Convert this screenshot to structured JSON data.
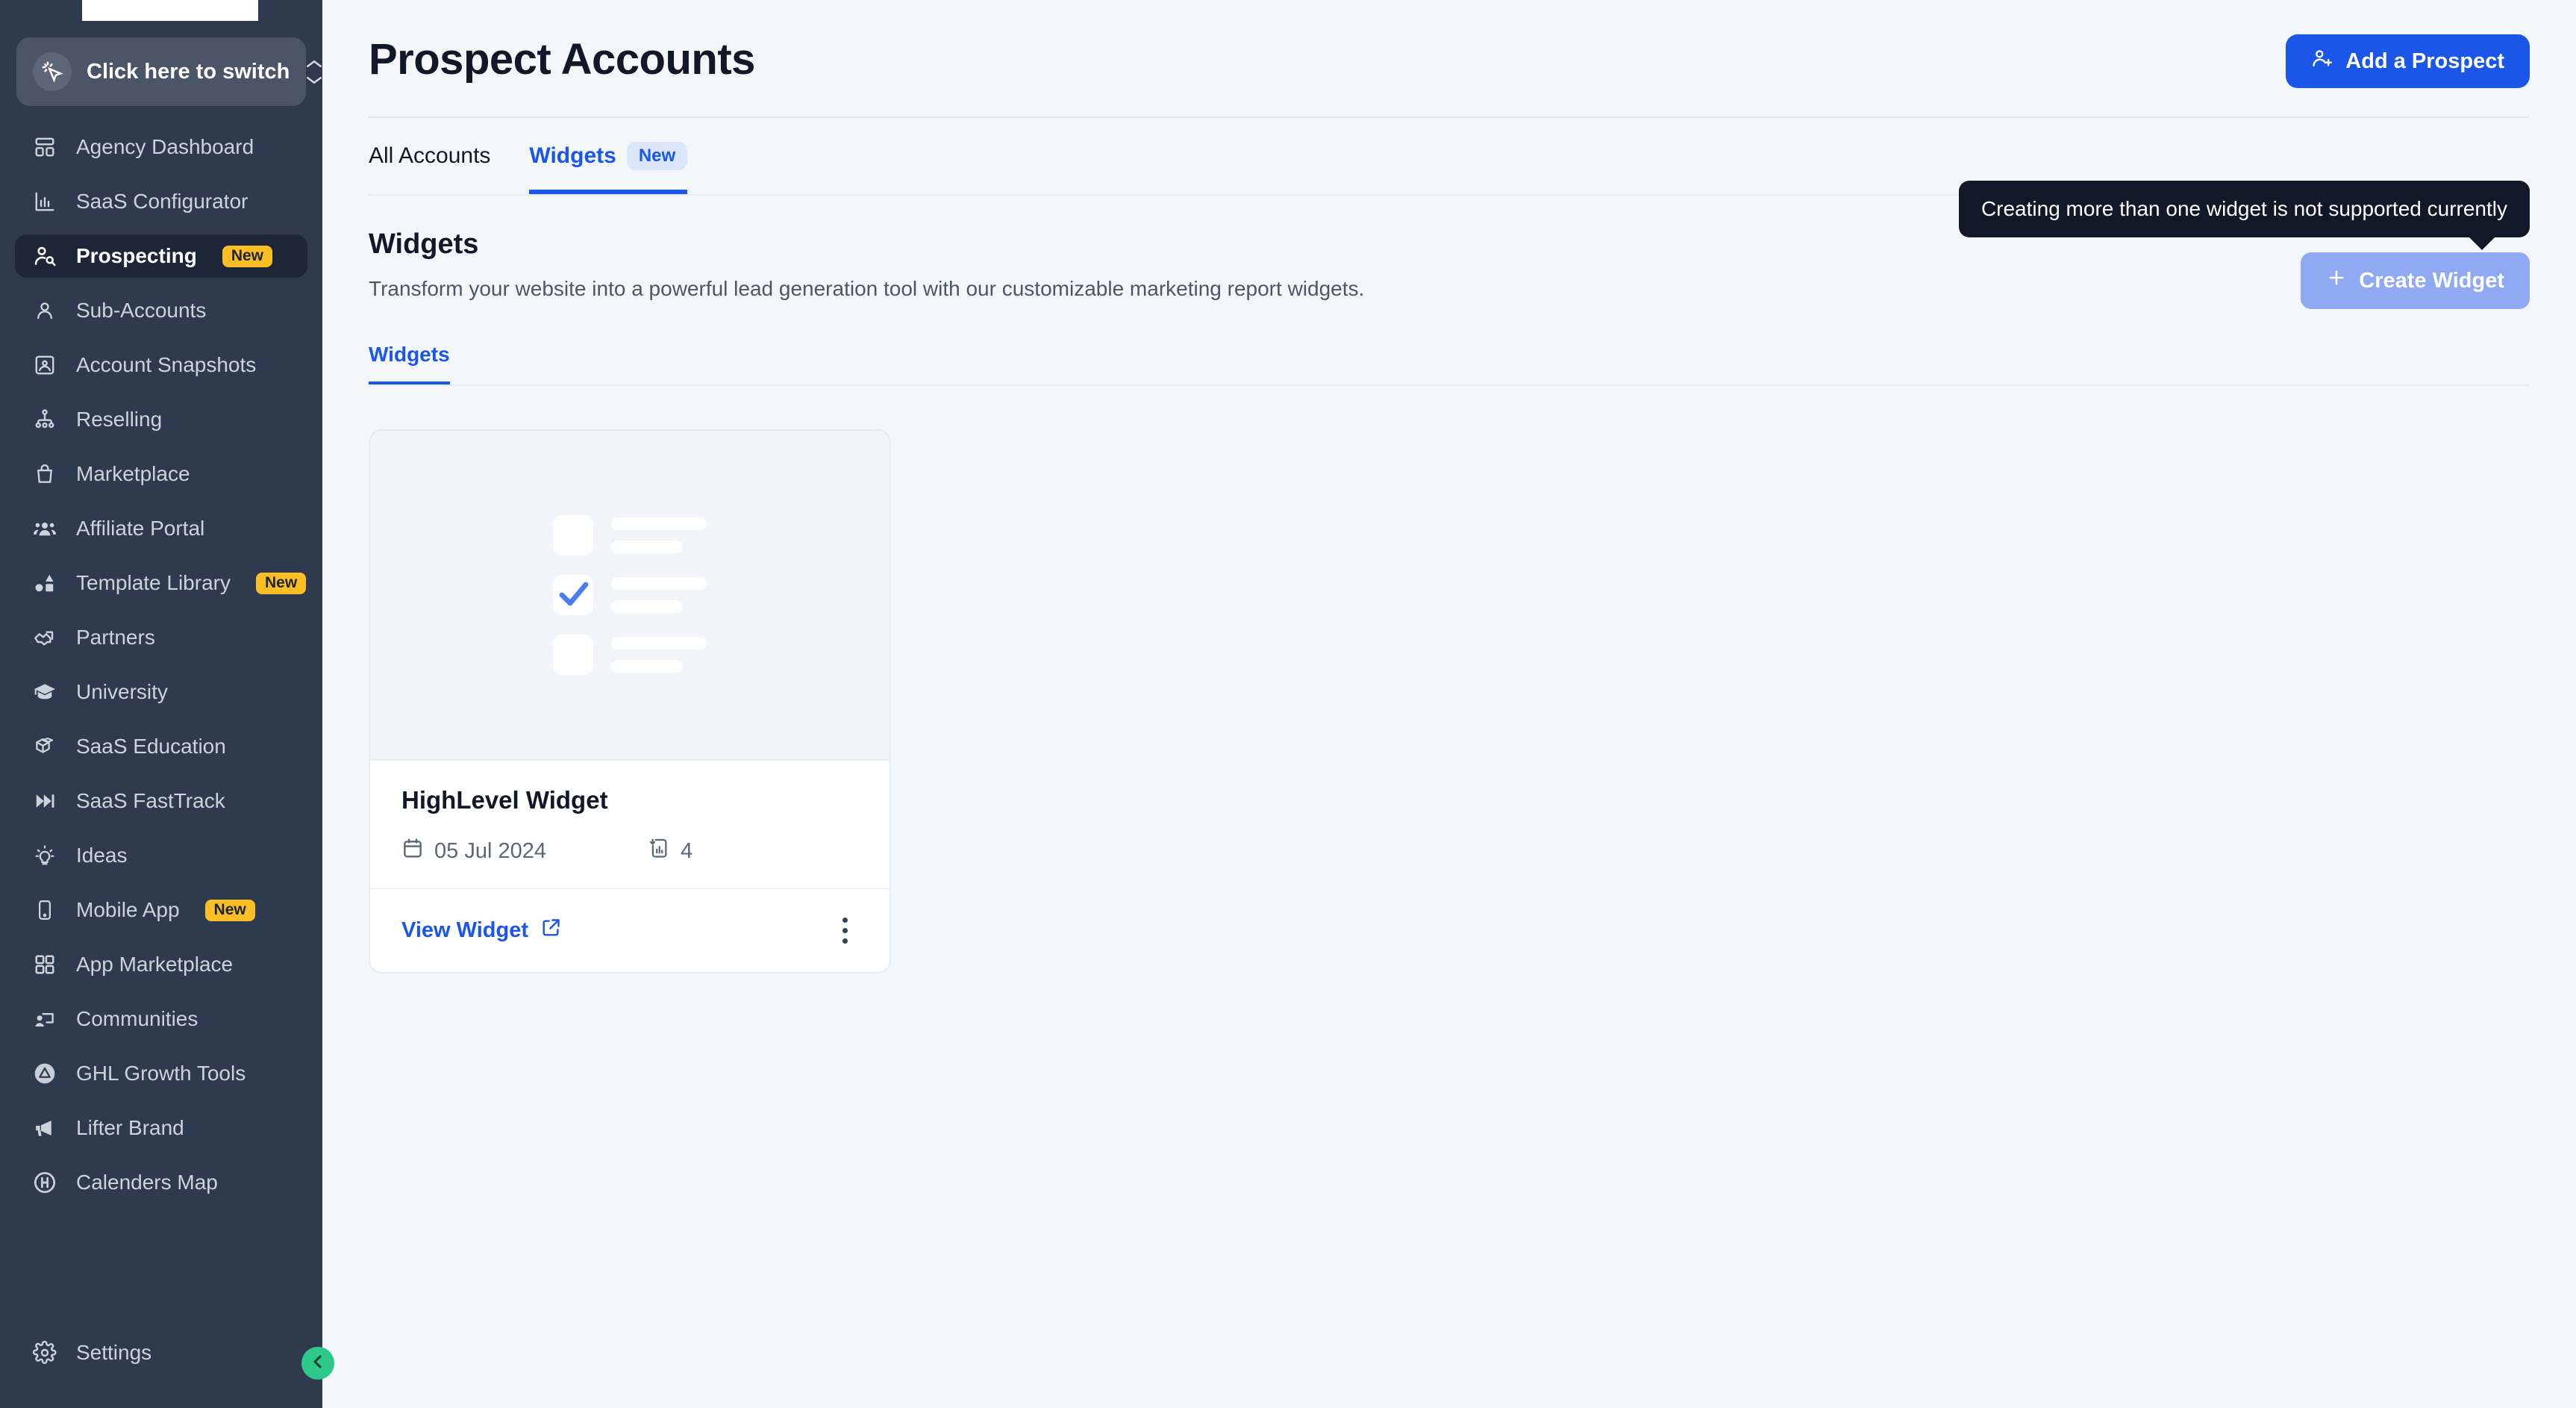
{
  "sidebar": {
    "switcher": {
      "label": "Click here to switch",
      "icon": "cursor-click-icon"
    },
    "items": [
      {
        "label": "Agency Dashboard",
        "icon": "dashboard-icon",
        "active": false,
        "badge": null
      },
      {
        "label": "SaaS Configurator",
        "icon": "bar-chart-icon",
        "active": false,
        "badge": null
      },
      {
        "label": "Prospecting",
        "icon": "user-search-icon",
        "active": true,
        "badge": "New"
      },
      {
        "label": "Sub-Accounts",
        "icon": "user-icon",
        "active": false,
        "badge": null
      },
      {
        "label": "Account Snapshots",
        "icon": "image-user-icon",
        "active": false,
        "badge": null
      },
      {
        "label": "Reselling",
        "icon": "network-icon",
        "active": false,
        "badge": null
      },
      {
        "label": "Marketplace",
        "icon": "shopping-bag-icon",
        "active": false,
        "badge": null
      },
      {
        "label": "Affiliate Portal",
        "icon": "users-group-icon",
        "active": false,
        "badge": null
      },
      {
        "label": "Template Library",
        "icon": "shapes-icon",
        "active": false,
        "badge": "New"
      },
      {
        "label": "Partners",
        "icon": "handshake-icon",
        "active": false,
        "badge": null
      },
      {
        "label": "University",
        "icon": "graduation-cap-icon",
        "active": false,
        "badge": null
      },
      {
        "label": "SaaS Education",
        "icon": "box-graduation-icon",
        "active": false,
        "badge": null
      },
      {
        "label": "SaaS FastTrack",
        "icon": "fast-forward-icon",
        "active": false,
        "badge": null
      },
      {
        "label": "Ideas",
        "icon": "lightbulb-icon",
        "active": false,
        "badge": null
      },
      {
        "label": "Mobile App",
        "icon": "mobile-phone-icon",
        "active": false,
        "badge": "New"
      },
      {
        "label": "App Marketplace",
        "icon": "grid-apps-icon",
        "active": false,
        "badge": null
      },
      {
        "label": "Communities",
        "icon": "community-icon",
        "active": false,
        "badge": null
      },
      {
        "label": "GHL Growth Tools",
        "icon": "growth-circle-icon",
        "active": false,
        "badge": null
      },
      {
        "label": "Lifter Brand",
        "icon": "megaphone-icon",
        "active": false,
        "badge": null
      },
      {
        "label": "Calenders Map",
        "icon": "h-circle-icon",
        "active": false,
        "badge": null
      }
    ],
    "settings": {
      "label": "Settings",
      "icon": "gear-icon"
    },
    "collapse": {
      "icon": "chevron-left-icon"
    }
  },
  "header": {
    "title": "Prospect Accounts",
    "add_prospect_label": "Add a Prospect",
    "add_prospect_icon": "user-plus-icon"
  },
  "tabs": [
    {
      "label": "All Accounts",
      "active": false,
      "badge": null
    },
    {
      "label": "Widgets",
      "active": true,
      "badge": "New"
    }
  ],
  "section": {
    "title": "Widgets",
    "description": "Transform your website into a powerful lead generation tool with our customizable marketing report widgets.",
    "subtab_label": "Widgets"
  },
  "create_widget": {
    "label": "Create Widget",
    "icon": "plus-icon",
    "disabled": true,
    "tooltip": "Creating more than one widget is not supported currently"
  },
  "widget_cards": [
    {
      "title": "HighLevel Widget",
      "date": "05 Jul 2024",
      "date_icon": "calendar-icon",
      "reports_count": "4",
      "reports_icon": "file-bar-chart-icon",
      "view_label": "View Widget",
      "view_icon": "external-link-icon",
      "menu_icon": "kebab-menu-icon"
    }
  ],
  "colors": {
    "accent_blue": "#1a56e8",
    "sidebar_bg": "#2e3a4d",
    "page_bg": "#f4f7fa",
    "badge_yellow": "#fbbf24",
    "collapse_green": "#2dc98a",
    "tooltip_bg": "#111827"
  }
}
